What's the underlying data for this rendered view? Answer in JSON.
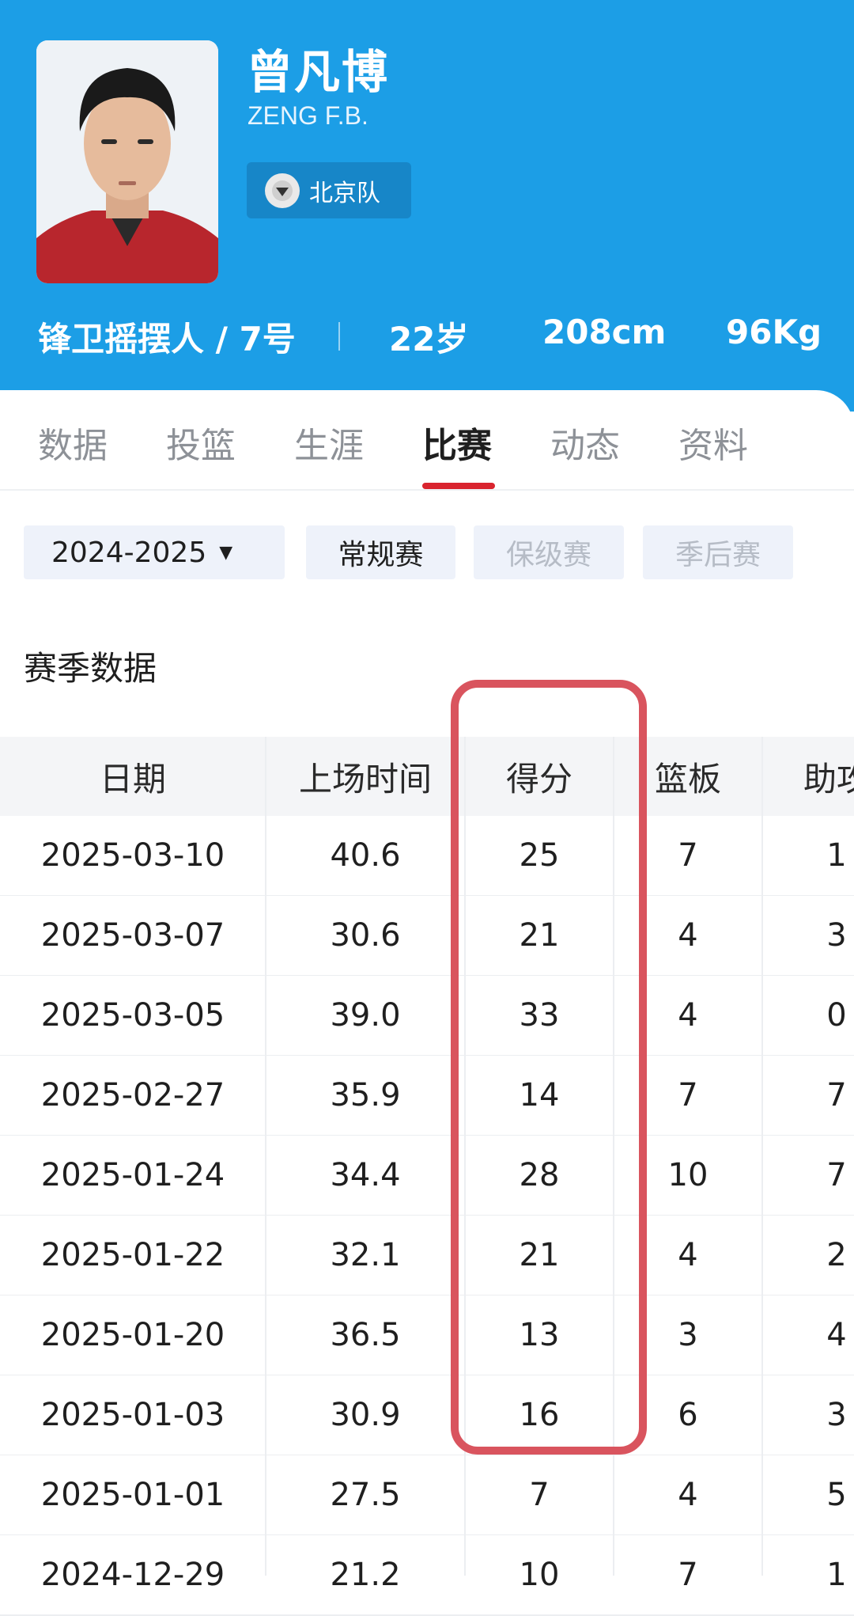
{
  "player": {
    "name": "曾凡博",
    "name_en": "ZENG F.B.",
    "team": "北京队",
    "position_number": "锋卫摇摆人 / 7号",
    "age": "22岁",
    "height": "208cm",
    "weight": "96Kg"
  },
  "tabs": [
    {
      "label": "数据"
    },
    {
      "label": "投篮"
    },
    {
      "label": "生涯"
    },
    {
      "label": "比赛",
      "active": true
    },
    {
      "label": "动态"
    },
    {
      "label": "资料"
    }
  ],
  "filters": {
    "season": "2024-2025",
    "types": [
      "常规赛",
      "保级赛",
      "季后赛"
    ],
    "selected": "常规赛"
  },
  "section_title": "赛季数据",
  "table": {
    "headers": [
      "日期",
      "上场时间",
      "得分",
      "篮板",
      "助攻"
    ],
    "rows": [
      [
        "2025-03-10",
        "40.6",
        "25",
        "7",
        "1"
      ],
      [
        "2025-03-07",
        "30.6",
        "21",
        "4",
        "3"
      ],
      [
        "2025-03-05",
        "39.0",
        "33",
        "4",
        "0"
      ],
      [
        "2025-02-27",
        "35.9",
        "14",
        "7",
        "7"
      ],
      [
        "2025-01-24",
        "34.4",
        "28",
        "10",
        "7"
      ],
      [
        "2025-01-22",
        "32.1",
        "21",
        "4",
        "2"
      ],
      [
        "2025-01-20",
        "36.5",
        "13",
        "3",
        "4"
      ],
      [
        "2025-01-03",
        "30.9",
        "16",
        "6",
        "3"
      ],
      [
        "2025-01-01",
        "27.5",
        "7",
        "4",
        "5"
      ],
      [
        "2024-12-29",
        "21.2",
        "10",
        "7",
        "1"
      ]
    ]
  },
  "colors": {
    "header_bg": "#1c9ee6",
    "accent_red": "#d9242e",
    "highlight_box": "#d9545e"
  }
}
